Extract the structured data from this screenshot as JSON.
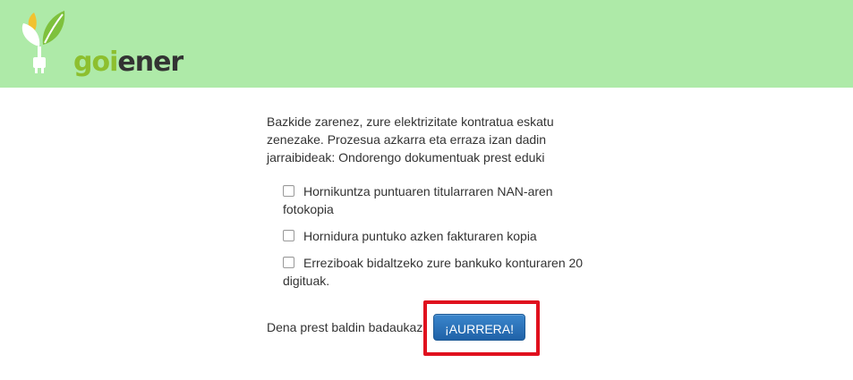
{
  "header": {
    "logo": {
      "text_part1": "goi",
      "text_part2": "ener",
      "icon": "leaf-plug-icon"
    },
    "background_color": "#aeeaa8"
  },
  "main": {
    "intro": "Bazkide zarenez, zure elektrizitate kontratua eskatu zenezake. Prozesua azkarra eta erraza izan dadin jarraibideak: Ondorengo dokumentuak prest eduki",
    "checklist": [
      {
        "label": "Hornikuntza puntuaren titularraren NAN-aren fotokopia",
        "checked": false
      },
      {
        "label": "Hornidura puntuko azken fakturaren kopia",
        "checked": false
      },
      {
        "label": "Erreziboak bidaltzeko zure bankuko konturaren 20 digituak.",
        "checked": false
      }
    ],
    "ready_text": "Dena prest baldin badaukaz",
    "go_button_label": "¡AURRERA!",
    "button_color": "#2b72b8",
    "highlight_color": "#e0101e"
  }
}
